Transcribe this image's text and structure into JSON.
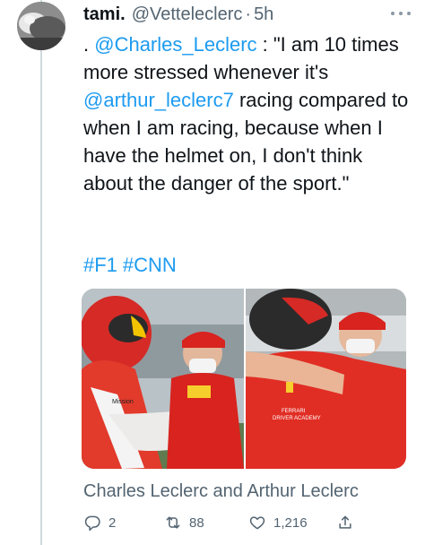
{
  "tweet": {
    "display_name": "tami.",
    "handle": "@Vetteleclerc",
    "separator": "·",
    "time": "5h",
    "text_parts": [
      ". ",
      "@Charles_Leclerc",
      " : \"I am 10 times more stressed whenever it's ",
      "@arthur_leclerc7",
      " racing compared to when I am racing, because when I have the helmet on, I don't think about the danger of the sport.\""
    ],
    "hashtags": [
      "#F1",
      "#CNN"
    ],
    "media_caption": "Charles Leclerc and Arthur Leclerc",
    "media_left_shirt_text": "Mission",
    "media_right_shirt_text_line1": "FERRARI",
    "media_right_shirt_text_line2": "DRIVER ACADEMY"
  },
  "actions": {
    "reply_count": "2",
    "retweet_count": "88",
    "like_count": "1,216"
  },
  "icons": {
    "more": "more-icon",
    "reply": "reply-icon",
    "retweet": "retweet-icon",
    "like": "heart-icon",
    "share": "share-icon"
  },
  "colors": {
    "link": "#1d9bf0",
    "secondary_text": "#536471",
    "primary_text": "#0f1419",
    "thread_line": "#cfd9de"
  }
}
